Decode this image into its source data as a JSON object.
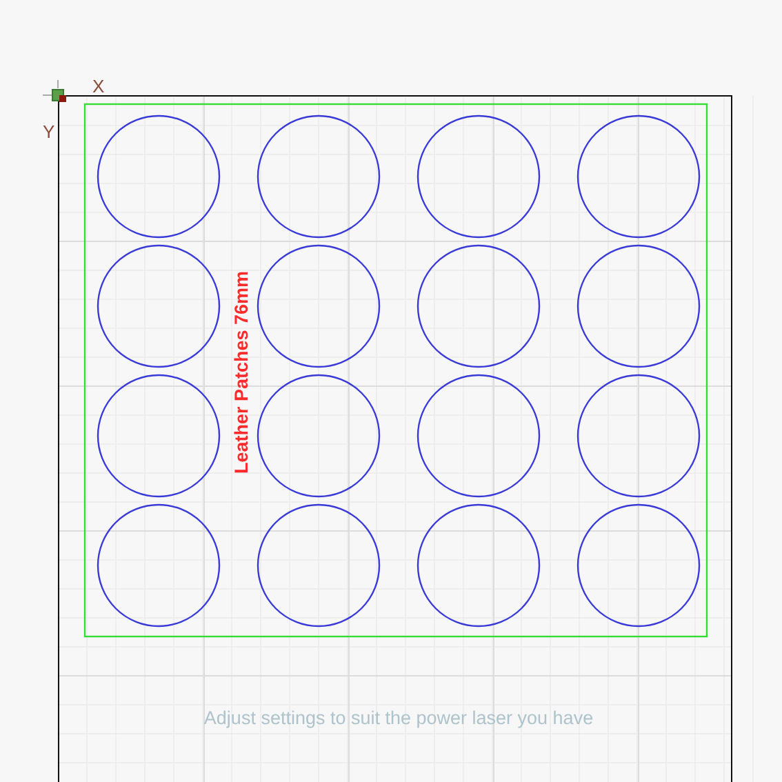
{
  "canvas": {
    "axis_labels": [
      {
        "kind": "x",
        "text": "X"
      },
      {
        "kind": "y",
        "text": "Y"
      }
    ],
    "shape_text": "Leather Patches 76mm",
    "caption": "Adjust settings to suit the power laser you have"
  }
}
